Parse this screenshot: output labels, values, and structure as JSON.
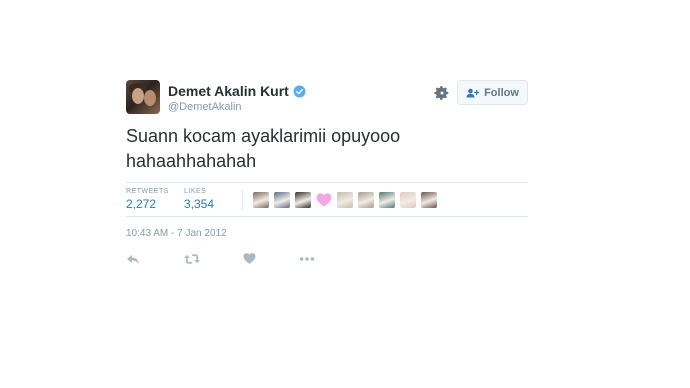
{
  "tweet": {
    "author": {
      "name": "Demet Akalin Kurt",
      "handle": "@DemetAkalin",
      "verified": true
    },
    "follow_label": "Follow",
    "text_line1": "Suann kocam ayaklarimii opuyooo",
    "text_line2": "hahaahhahahah",
    "stats": {
      "retweets_label": "RETWEETS",
      "retweets_value": "2,272",
      "likes_label": "LIKES",
      "likes_value": "3,354"
    },
    "likers": [
      {
        "icon": "liker-avatar",
        "color": "#7a6a5a"
      },
      {
        "icon": "liker-avatar",
        "color": "#5d6f86"
      },
      {
        "icon": "liker-avatar",
        "color": "#2e2e2e"
      },
      {
        "icon": "heart-avatar",
        "color": "#f3a6e6"
      },
      {
        "icon": "liker-avatar",
        "color": "#c9b9a4"
      },
      {
        "icon": "liker-avatar",
        "color": "#a89a88"
      },
      {
        "icon": "liker-avatar",
        "color": "#4d7b73"
      },
      {
        "icon": "liker-avatar",
        "color": "#e0c9c0"
      },
      {
        "icon": "liker-avatar",
        "color": "#6a5346"
      }
    ],
    "timestamp": "10:43 AM - 7 Jan 2012",
    "colors": {
      "link_blue": "#2b7bb9",
      "muted": "#8899a6",
      "verified_blue": "#55acee",
      "action_icon": "#aab8c2"
    }
  }
}
